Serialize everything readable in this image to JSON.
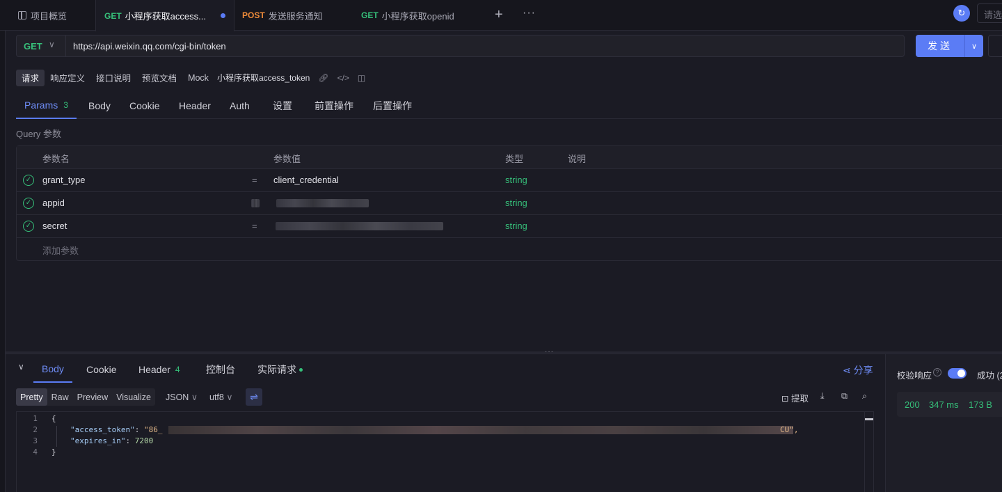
{
  "tabs": {
    "overview": "项目概览",
    "items": [
      {
        "method": "GET",
        "label": "小程序获取access..."
      },
      {
        "method": "POST",
        "label": "发送服务通知"
      },
      {
        "method": "GET",
        "label": "小程序获取openid"
      }
    ],
    "plus": "+",
    "more": "···"
  },
  "env_select_placeholder": "请选",
  "request": {
    "method": "GET",
    "url": "https://api.weixin.qq.com/cgi-bin/token",
    "send_label": "发送"
  },
  "subtabs": [
    "请求",
    "响应定义",
    "接口说明",
    "预览文档",
    "Mock"
  ],
  "api_name": "小程序获取access_token",
  "request_tabs": {
    "params": "Params",
    "params_count": "3",
    "others": [
      "Body",
      "Cookie",
      "Header",
      "Auth",
      "设置",
      "前置操作",
      "后置操作"
    ]
  },
  "query_label": "Query 参数",
  "params_table": {
    "headers": [
      "参数名",
      "参数值",
      "类型",
      "说明"
    ],
    "rows": [
      {
        "name": "grant_type",
        "eq": "=",
        "value": "client_credential",
        "type": "string"
      },
      {
        "name": "appid",
        "eq": "",
        "value": "",
        "type": "string"
      },
      {
        "name": "secret",
        "eq": "=",
        "value": "",
        "type": "string"
      }
    ],
    "add_label": "添加参数"
  },
  "response": {
    "tabs": {
      "body": "Body",
      "cookie": "Cookie",
      "header": "Header",
      "header_count": "4",
      "console": "控制台",
      "actual": "实际请求"
    },
    "share": "分享",
    "formats": [
      "Pretty",
      "Raw",
      "Preview",
      "Visualize"
    ],
    "format_select": "JSON",
    "encoding_select": "utf8",
    "extract": "提取",
    "code": {
      "line_numbers": [
        "1",
        "2",
        "3",
        "4"
      ],
      "open_brace": "{",
      "token_key": "\"access_token\"",
      "token_prefix": "\"86_",
      "token_suffix": "CU\",",
      "expires_key": "\"expires_in\"",
      "expires_value": "7200",
      "close_brace": "}"
    }
  },
  "validation": {
    "label": "校验响应",
    "help": "?",
    "result": "成功 (2",
    "status": "200",
    "time": "347 ms",
    "size": "173 B"
  }
}
